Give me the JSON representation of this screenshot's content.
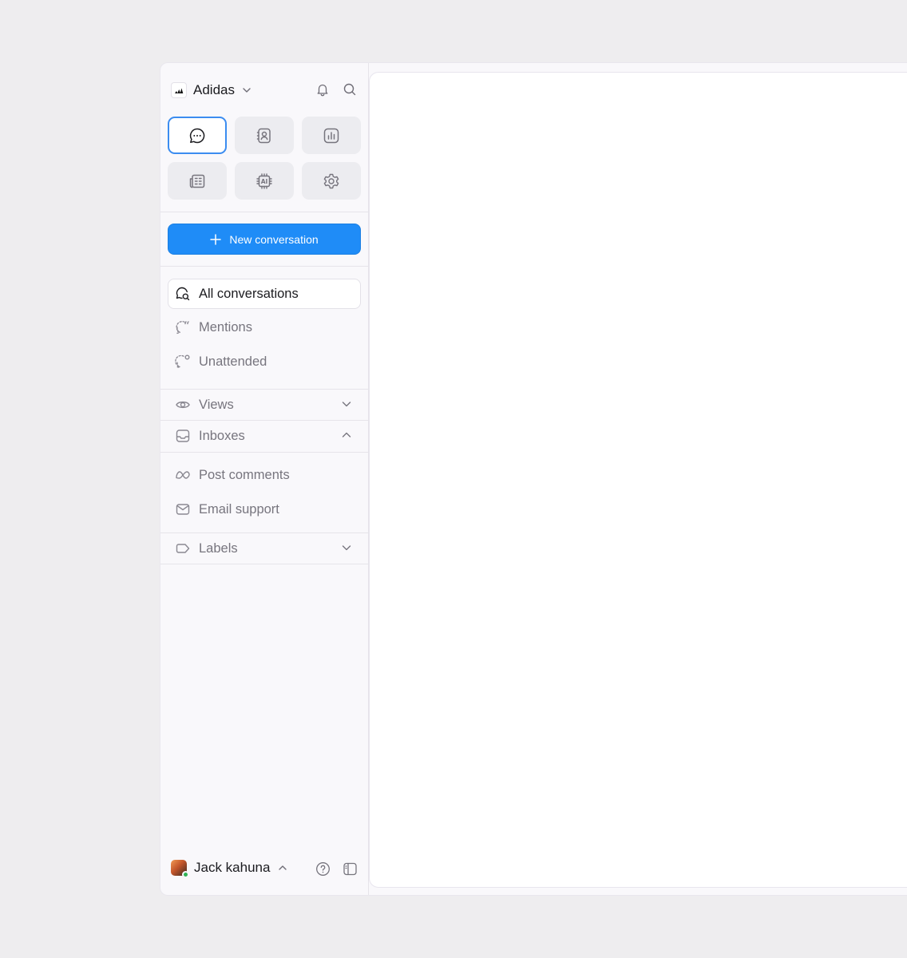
{
  "workspace": {
    "name": "Adidas",
    "logo_icon": "adidas-logo-icon"
  },
  "header_icons": [
    "bell-icon",
    "search-icon"
  ],
  "app_tiles": [
    {
      "icon": "chat-bubble-icon",
      "active": true
    },
    {
      "icon": "contacts-icon",
      "active": false
    },
    {
      "icon": "bar-chart-icon",
      "active": false
    },
    {
      "icon": "newspaper-icon",
      "active": false
    },
    {
      "icon": "ai-chip-icon",
      "active": false
    },
    {
      "icon": "gear-icon",
      "active": false
    }
  ],
  "new_conversation": {
    "label": "New conversation",
    "icon": "plus-icon"
  },
  "nav": [
    {
      "label": "All conversations",
      "icon": "conversations-search-icon",
      "active": true
    },
    {
      "label": "Mentions",
      "icon": "mention-bubble-icon",
      "active": false
    },
    {
      "label": "Unattended",
      "icon": "unattended-bubble-icon",
      "active": false
    }
  ],
  "sections": {
    "views": {
      "label": "Views",
      "icon": "eye-icon",
      "expanded": false
    },
    "inboxes": {
      "label": "Inboxes",
      "icon": "inbox-icon",
      "expanded": true
    },
    "labels": {
      "label": "Labels",
      "icon": "label-tag-icon",
      "expanded": false
    }
  },
  "inboxes": [
    {
      "label": "Post comments",
      "icon": "meta-icon"
    },
    {
      "label": "Email support",
      "icon": "mail-icon"
    }
  ],
  "user": {
    "name": "Jack kahuna",
    "status": "online",
    "status_color": "#2fb356"
  },
  "footer_icons": [
    "help-icon",
    "sidebar-toggle-icon"
  ],
  "colors": {
    "accent": "#1f8cf7",
    "background": "#eeedef",
    "sidebar": "#f9f8fb"
  }
}
